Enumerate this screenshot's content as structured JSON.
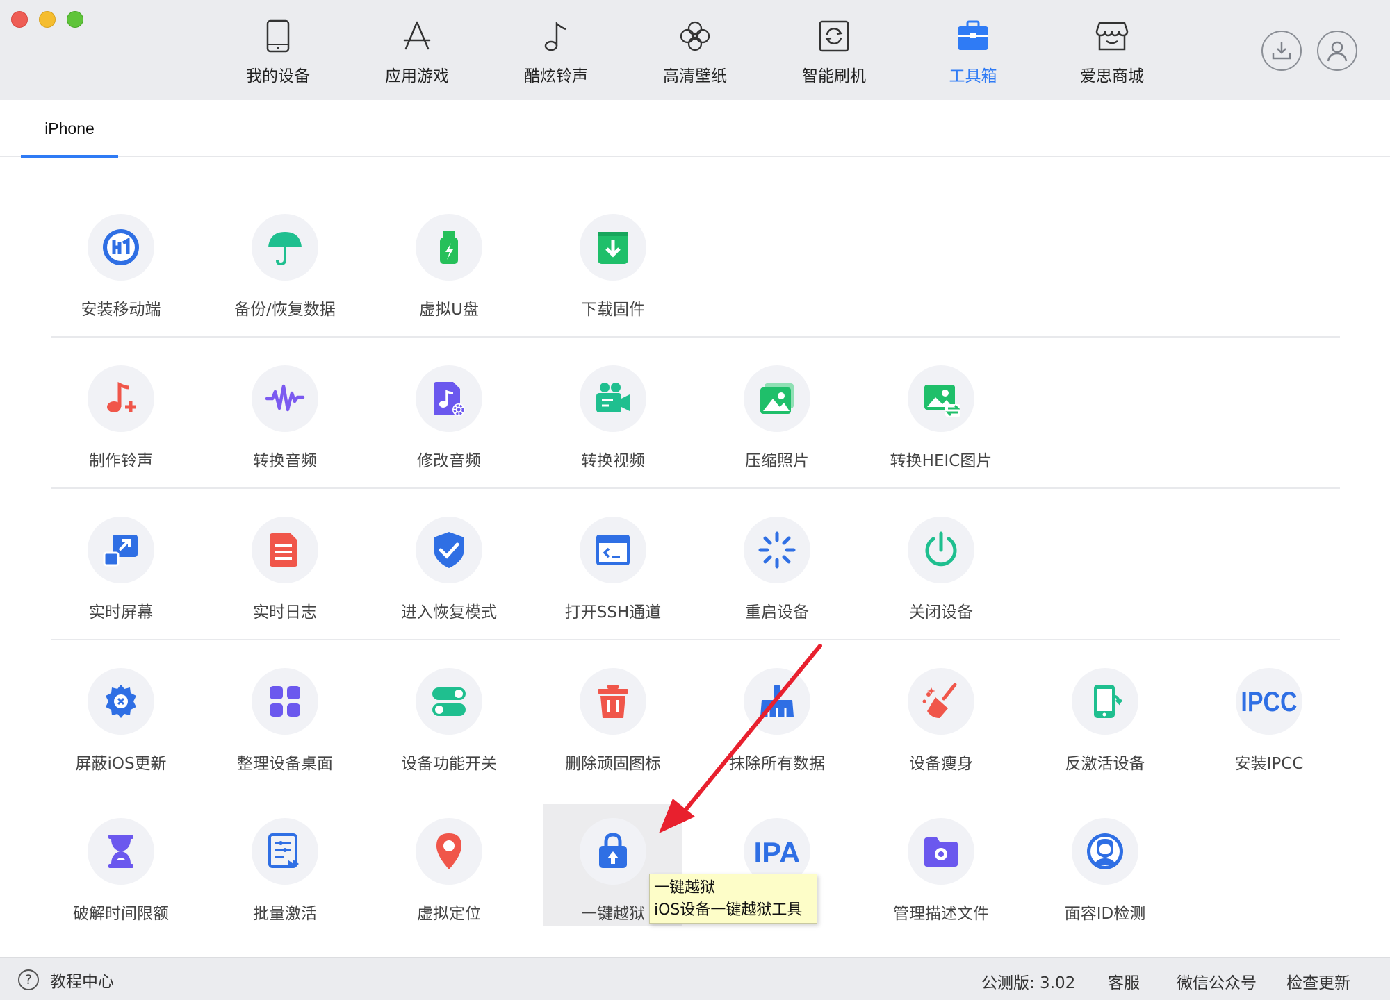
{
  "window": {
    "traffic_lights": [
      "close",
      "minimize",
      "zoom"
    ]
  },
  "nav": {
    "items": [
      {
        "label": "我的设备",
        "icon": "phone-icon"
      },
      {
        "label": "应用游戏",
        "icon": "app-store-icon"
      },
      {
        "label": "酷炫铃声",
        "icon": "music-note-icon"
      },
      {
        "label": "高清壁纸",
        "icon": "flower-icon"
      },
      {
        "label": "智能刷机",
        "icon": "flash-refresh-icon"
      },
      {
        "label": "工具箱",
        "icon": "toolbox-icon",
        "active": true
      },
      {
        "label": "爱思商城",
        "icon": "store-icon"
      }
    ],
    "active_color": "#2f7bf5",
    "right_buttons": [
      "download-icon",
      "user-icon"
    ]
  },
  "tabs": [
    {
      "label": "iPhone",
      "active": true
    }
  ],
  "tools": {
    "row1": [
      {
        "label": "安装移动端",
        "icon": "install-mobile-icon",
        "color": "#2f6fe4"
      },
      {
        "label": "备份/恢复数据",
        "icon": "umbrella-icon",
        "color": "#1fbf8f"
      },
      {
        "label": "虚拟U盘",
        "icon": "usb-drive-icon",
        "color": "#26c05a"
      },
      {
        "label": "下载固件",
        "icon": "firmware-download-icon",
        "color": "#1fbf6a"
      }
    ],
    "row2": [
      {
        "label": "制作铃声",
        "icon": "ringtone-maker-icon",
        "color": "#f0564a"
      },
      {
        "label": "转换音频",
        "icon": "audio-wave-icon",
        "color": "#7b5af0"
      },
      {
        "label": "修改音频",
        "icon": "edit-audio-icon",
        "color": "#6b58ee"
      },
      {
        "label": "转换视频",
        "icon": "video-camera-icon",
        "color": "#1fbf8f"
      },
      {
        "label": "压缩照片",
        "icon": "photo-compress-icon",
        "color": "#1fbf6a"
      },
      {
        "label": "转换HEIC图片",
        "icon": "heic-convert-icon",
        "color": "#1fbf6a"
      }
    ],
    "row3": [
      {
        "label": "实时屏幕",
        "icon": "live-screen-icon",
        "color": "#2f6fe4"
      },
      {
        "label": "实时日志",
        "icon": "log-file-icon",
        "color": "#f0564a"
      },
      {
        "label": "进入恢复模式",
        "icon": "shield-check-icon",
        "color": "#2f6fe4"
      },
      {
        "label": "打开SSH通道",
        "icon": "terminal-window-icon",
        "color": "#2f6fe4"
      },
      {
        "label": "重启设备",
        "icon": "restart-spinner-icon",
        "color": "#2f6fe4"
      },
      {
        "label": "关闭设备",
        "icon": "power-icon",
        "color": "#1fbf8f"
      }
    ],
    "row4": [
      {
        "label": "屏蔽iOS更新",
        "icon": "gear-block-icon",
        "color": "#2f6fe4"
      },
      {
        "label": "整理设备桌面",
        "icon": "grid-apps-icon",
        "color": "#6b58ee"
      },
      {
        "label": "设备功能开关",
        "icon": "toggle-switches-icon",
        "color": "#1fbf8f"
      },
      {
        "label": "删除顽固图标",
        "icon": "trash-icon",
        "color": "#f0564a"
      },
      {
        "label": "抹除所有数据",
        "icon": "erase-broom-icon",
        "color": "#2f6fe4"
      },
      {
        "label": "设备瘦身",
        "icon": "clean-broom-icon",
        "color": "#f0564a"
      },
      {
        "label": "反激活设备",
        "icon": "deactivate-phone-icon",
        "color": "#1fbf8f"
      },
      {
        "label": "安装IPCC",
        "icon": "ipcc-text-icon",
        "color": "#2f6fe4"
      }
    ],
    "row5": [
      {
        "label": "破解时间限额",
        "icon": "hourglass-icon",
        "color": "#6b58ee"
      },
      {
        "label": "批量激活",
        "icon": "batch-activate-icon",
        "color": "#2f6fe4"
      },
      {
        "label": "虚拟定位",
        "icon": "location-pin-icon",
        "color": "#f0564a"
      },
      {
        "label": "一键越狱",
        "icon": "jailbreak-lock-icon",
        "color": "#2f6fe4",
        "hovered": true
      },
      {
        "label": "",
        "icon": "ipa-text-icon",
        "color": "#2f6fe4"
      },
      {
        "label": "管理描述文件",
        "icon": "profile-folder-icon",
        "color": "#6b58ee"
      },
      {
        "label": "面容ID检测",
        "icon": "face-id-icon",
        "color": "#2f6fe4"
      }
    ]
  },
  "tooltip": {
    "line1": "一键越狱",
    "line2": "iOS设备一键越狱工具"
  },
  "footer": {
    "help_label": "教程中心",
    "version": "公测版: 3.02",
    "links": [
      "客服",
      "微信公众号",
      "检查更新"
    ]
  }
}
